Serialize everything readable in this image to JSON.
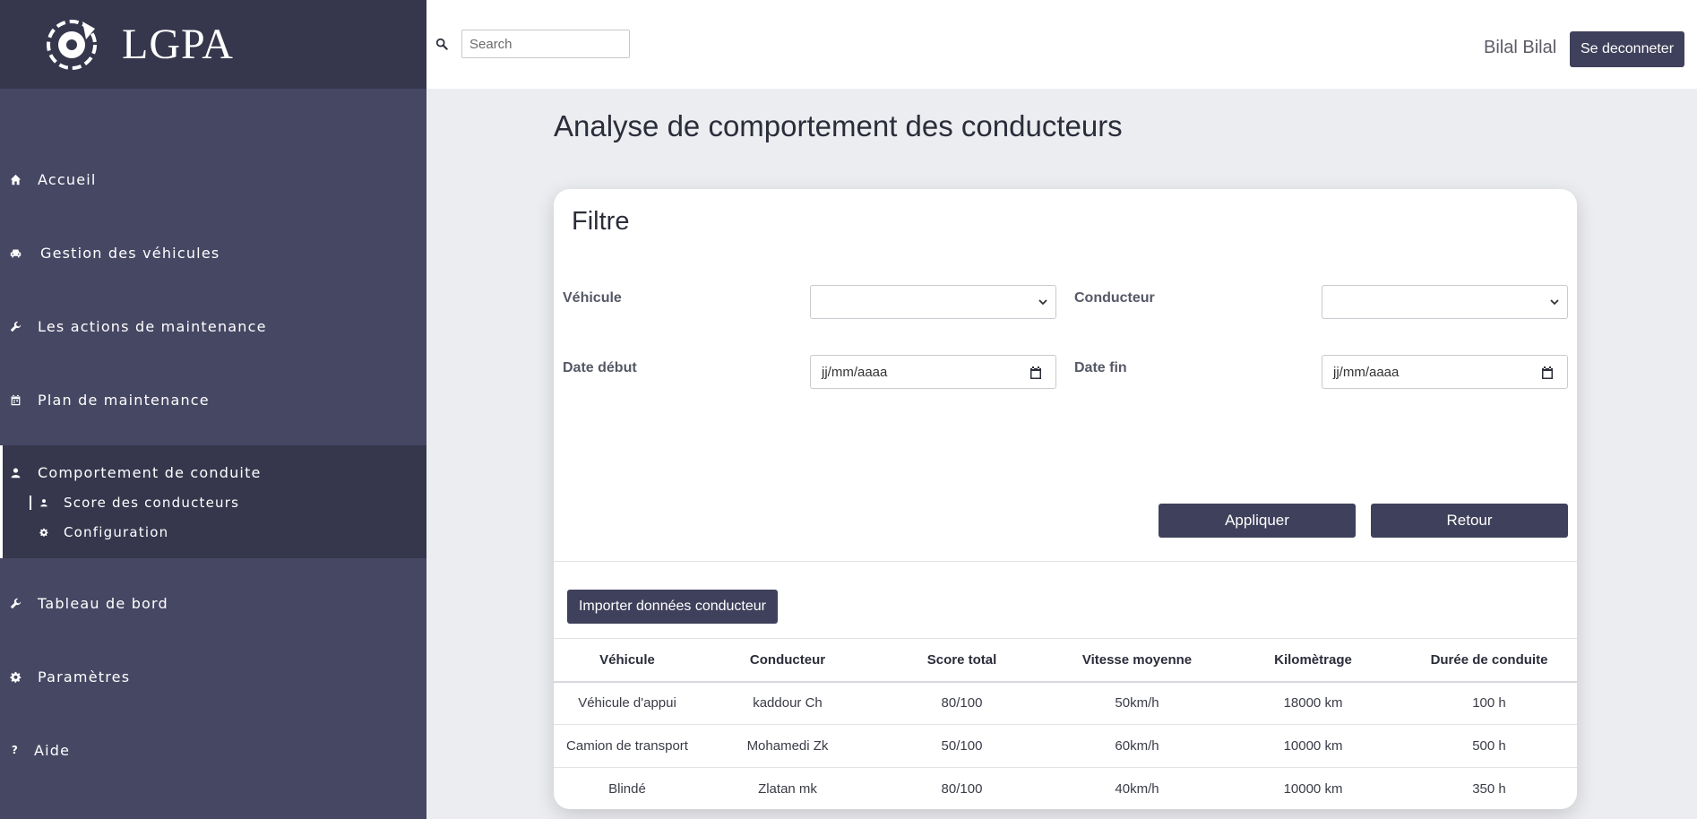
{
  "brand": {
    "name": "LGPA"
  },
  "sidebar": {
    "items": [
      {
        "label": "Accueil",
        "icon": "home-icon"
      },
      {
        "label": "Gestion des véhicules",
        "icon": "car-icon"
      },
      {
        "label": "Les actions de maintenance",
        "icon": "wrench-icon"
      },
      {
        "label": "Plan de maintenance",
        "icon": "calendar-icon"
      },
      {
        "label": "Comportement de conduite",
        "icon": "user-icon"
      },
      {
        "label": "Tableau de bord",
        "icon": "wrench-icon"
      },
      {
        "label": "Paramètres",
        "icon": "gear-icon"
      },
      {
        "label": "Aide",
        "icon": "question-icon"
      }
    ],
    "sub_items": [
      {
        "label": "Score des conducteurs",
        "icon": "user-icon"
      },
      {
        "label": "Configuration",
        "icon": "gear-icon"
      }
    ]
  },
  "header": {
    "search_placeholder": "Search",
    "user_name": "Bilal Bilal",
    "logout_label": "Se deconneter"
  },
  "main": {
    "title": "Analyse de comportement des conducteurs",
    "filter": {
      "title": "Filtre",
      "vehicle_label": "Véhicule",
      "driver_label": "Conducteur",
      "start_date_label": "Date début",
      "end_date_label": "Date fin",
      "date_placeholder": "jj/mm/aaaa",
      "apply_label": "Appliquer",
      "back_label": "Retour"
    },
    "import_label": "Importer données conducteur",
    "table": {
      "headers": [
        "Véhicule",
        "Conducteur",
        "Score total",
        "Vitesse moyenne",
        "Kilomètrage",
        "Durée de conduite"
      ],
      "rows": [
        [
          "Véhicule d'appui",
          "kaddour Ch",
          "80/100",
          "50km/h",
          "18000 km",
          "100 h"
        ],
        [
          "Camion de transport",
          "Mohamedi Zk",
          "50/100",
          "60km/h",
          "10000 km",
          "500 h"
        ],
        [
          "Blindé",
          "Zlatan mk",
          "80/100",
          "40km/h",
          "10000 km",
          "350 h"
        ]
      ]
    }
  },
  "colors": {
    "sidebar": "#464763",
    "sidebar_dark": "#36374d",
    "accent_button": "#3f405b",
    "page_bg": "#ecedf0"
  }
}
